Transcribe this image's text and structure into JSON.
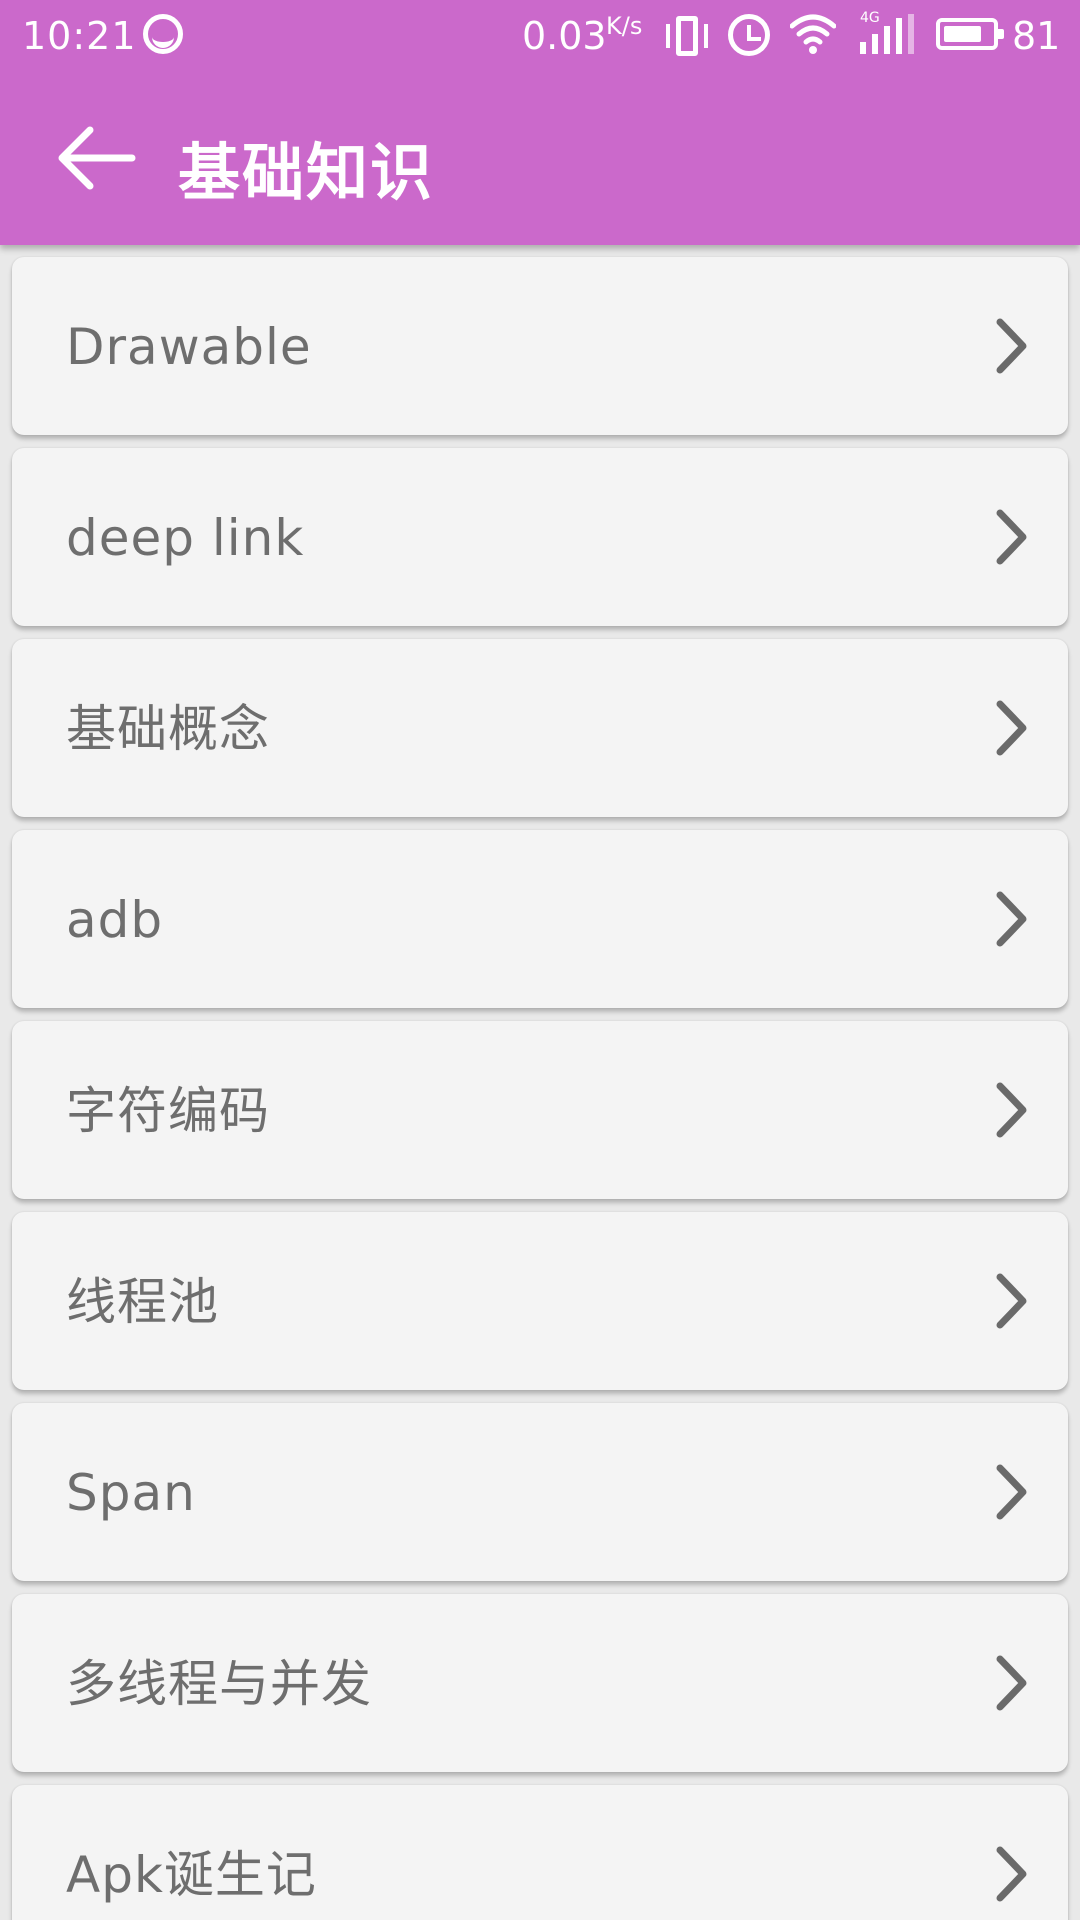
{
  "status_bar": {
    "time": "10:21",
    "network_speed": "0.03",
    "network_speed_unit": "K/s",
    "signal_label": "4G",
    "battery_level": "81",
    "battery_fraction": 0.81,
    "icons": [
      "messenger-icon",
      "vibrate-icon",
      "alarm-icon",
      "wifi-icon",
      "signal-icon",
      "battery-icon"
    ]
  },
  "toolbar": {
    "title": "基础知识",
    "back_icon": "arrow-left-icon"
  },
  "colors": {
    "toolbar_background": "#cb69cb",
    "card_background": "#f4f4f4",
    "text_primary": "#6e6e6e",
    "page_background": "#e9e9e9"
  },
  "list": {
    "items": [
      {
        "label": "Drawable"
      },
      {
        "label": "deep link"
      },
      {
        "label": "基础概念"
      },
      {
        "label": "adb"
      },
      {
        "label": "字符编码"
      },
      {
        "label": "线程池"
      },
      {
        "label": "Span"
      },
      {
        "label": "多线程与并发"
      },
      {
        "label": "Apk诞生记"
      }
    ],
    "item_icon": "chevron-right-icon"
  }
}
